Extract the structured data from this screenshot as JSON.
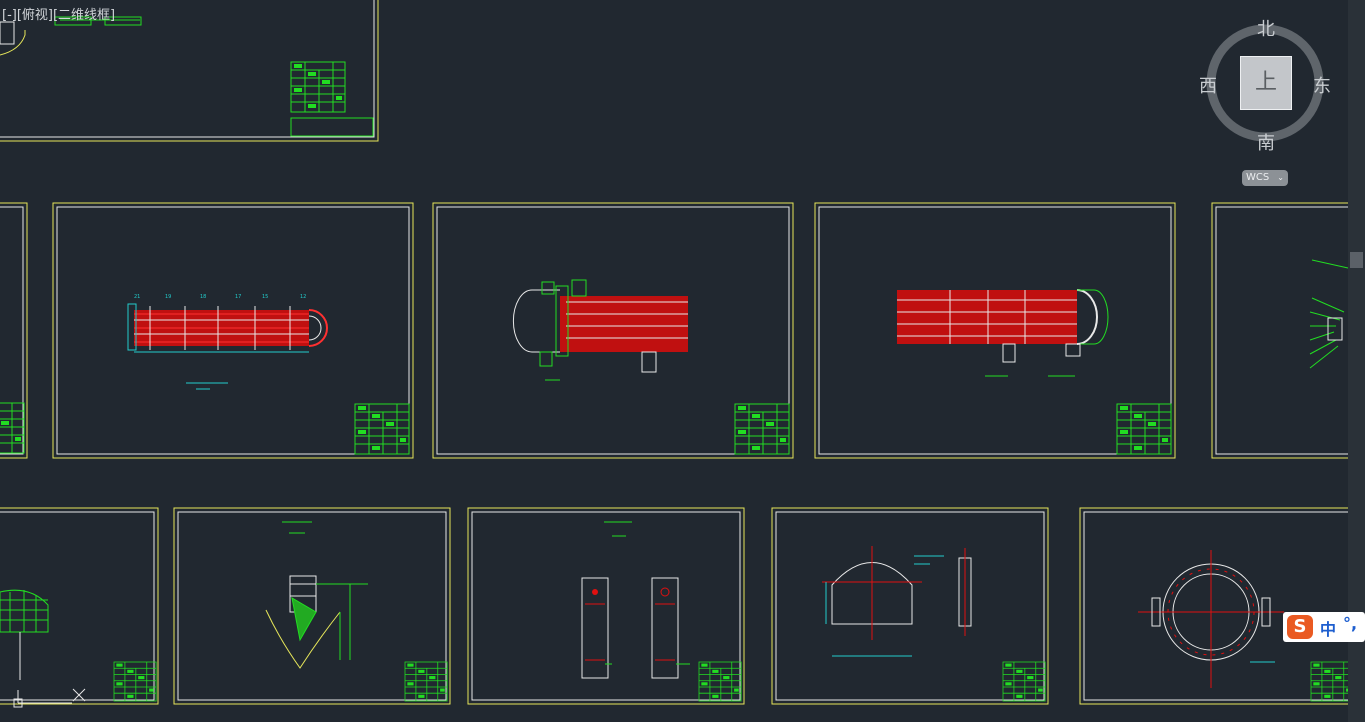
{
  "viewport": {
    "label": "[-][俯视][二维线框]"
  },
  "viewcube": {
    "north": "北",
    "south": "南",
    "west": "西",
    "east": "东",
    "face": "上",
    "wcs_label": "WCS",
    "wcs_arrow": "⌄"
  },
  "ime": {
    "logo": "S",
    "mode": "中",
    "punct": "°,"
  },
  "colors": {
    "background": "#212830",
    "frame": "#e6e65a",
    "drawing": "#e8e8e8",
    "tubes": "#e01010",
    "annotation": "#22dd22",
    "dimension": "#22cccc"
  },
  "sheets": [
    {
      "name": "sheet-top-left",
      "content": "assembly-partial"
    },
    {
      "name": "sheet-row1-edge",
      "content": "partial"
    },
    {
      "name": "sheet-row1-a",
      "content": "tube-bundle"
    },
    {
      "name": "sheet-row1-b",
      "content": "heat-exchanger-shell-left"
    },
    {
      "name": "sheet-row1-c",
      "content": "heat-exchanger-shell-right"
    },
    {
      "name": "sheet-row1-d",
      "content": "partial-detail"
    },
    {
      "name": "sheet-row2-edge",
      "content": "partial-detail"
    },
    {
      "name": "sheet-row2-a",
      "content": "saddle-detail"
    },
    {
      "name": "sheet-row2-b",
      "content": "support-plates"
    },
    {
      "name": "sheet-row2-c",
      "content": "head-detail"
    },
    {
      "name": "sheet-row2-d",
      "content": "flange-detail"
    }
  ]
}
